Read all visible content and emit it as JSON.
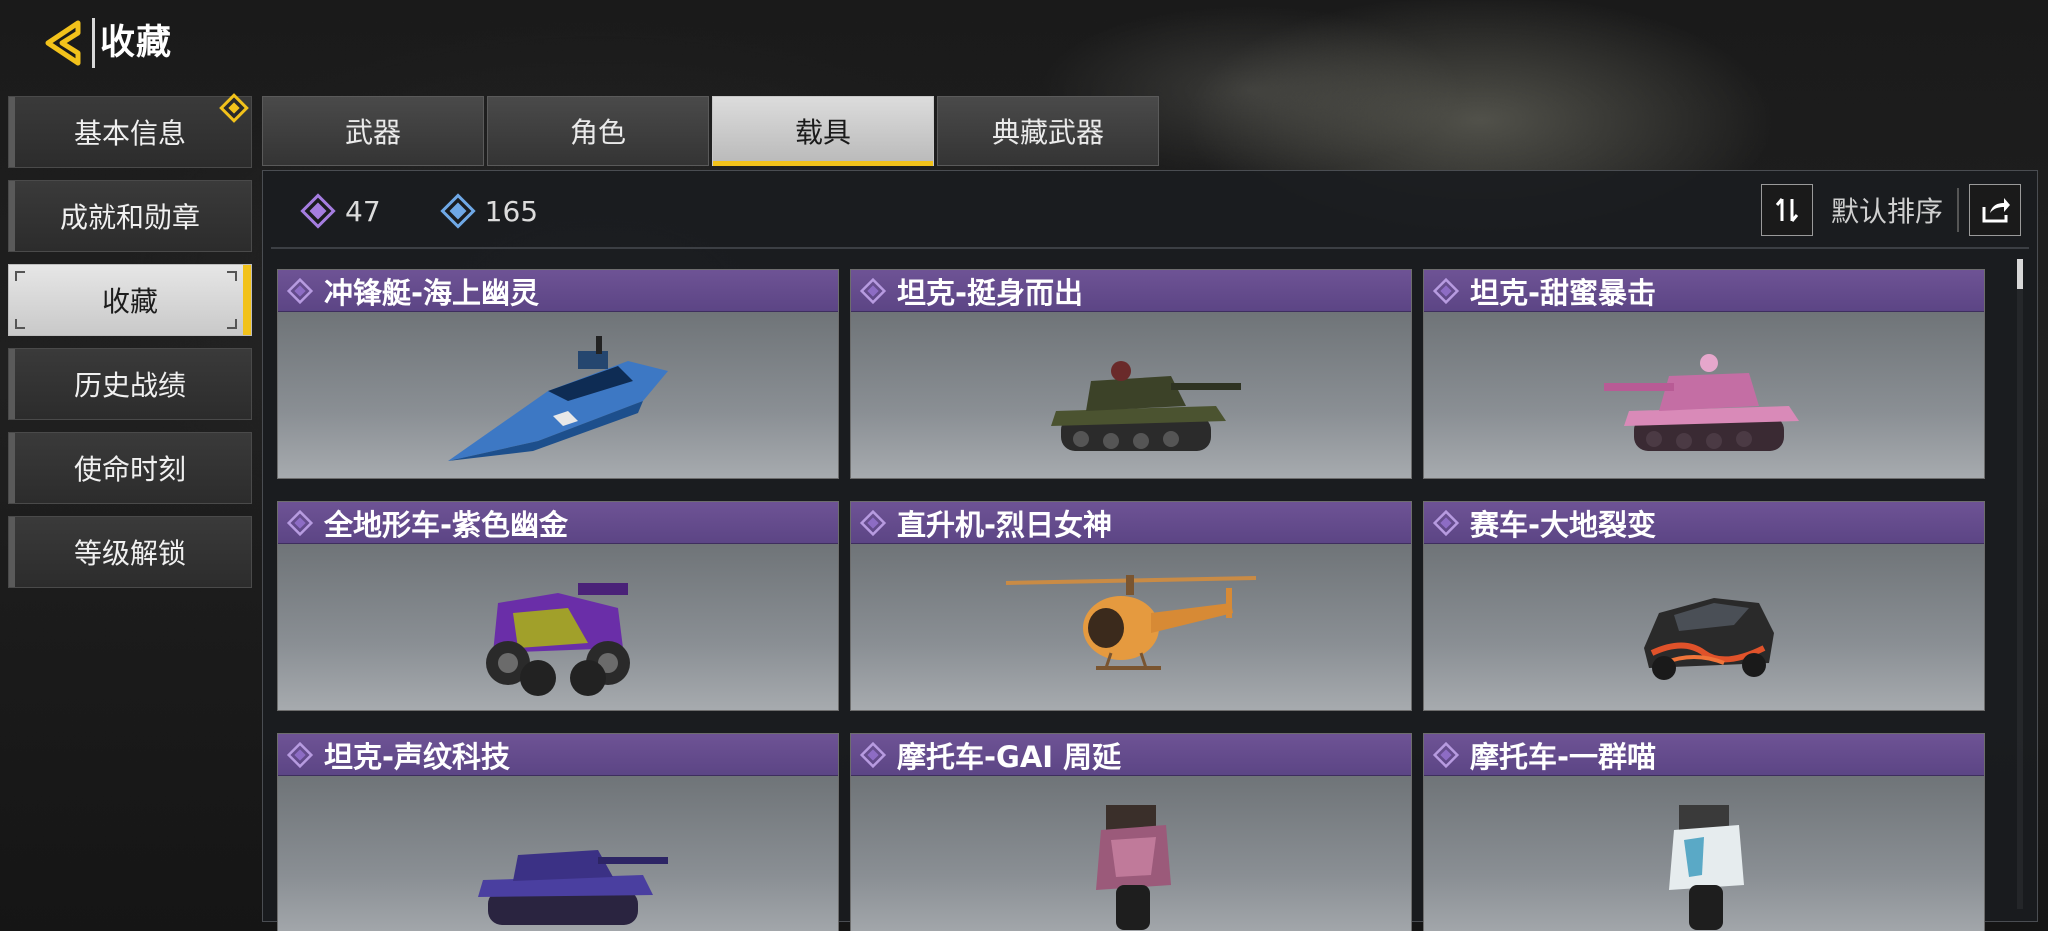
{
  "header": {
    "title": "收藏"
  },
  "sidebar": {
    "items": [
      {
        "label": "基本信息",
        "badge": true
      },
      {
        "label": "成就和勋章"
      },
      {
        "label": "收藏",
        "active": true
      },
      {
        "label": "历史战绩"
      },
      {
        "label": "使命时刻"
      },
      {
        "label": "等级解锁"
      }
    ]
  },
  "tabs": [
    {
      "label": "武器"
    },
    {
      "label": "角色"
    },
    {
      "label": "载具",
      "active": true
    },
    {
      "label": "典藏武器"
    }
  ],
  "stats": {
    "purple_count": "47",
    "blue_count": "165"
  },
  "toolbar": {
    "sort_label": "默认排序"
  },
  "colors": {
    "accent": "#f2c21b",
    "card_header": "#634a8c",
    "purple_gem": "#a57de0",
    "blue_gem": "#6fa8e6"
  },
  "vehicles": [
    {
      "name": "冲锋艇-海上幽灵",
      "icon": "speedboat-blue-icon"
    },
    {
      "name": "坦克-挺身而出",
      "icon": "tank-camo-icon"
    },
    {
      "name": "坦克-甜蜜暴击",
      "icon": "tank-pink-icon"
    },
    {
      "name": "全地形车-紫色幽金",
      "icon": "atv-purple-icon"
    },
    {
      "name": "直升机-烈日女神",
      "icon": "helicopter-orange-icon"
    },
    {
      "name": "赛车-大地裂变",
      "icon": "racecar-lava-icon"
    },
    {
      "name": "坦克-声纹科技",
      "icon": "tank-purple-icon"
    },
    {
      "name": "摩托车-GAI 周延",
      "icon": "motorcycle-pink-icon"
    },
    {
      "name": "摩托车-一群喵",
      "icon": "motorcycle-white-icon"
    }
  ]
}
